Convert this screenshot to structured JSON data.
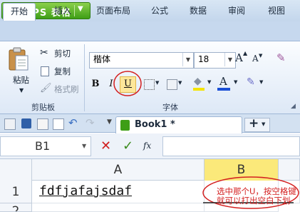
{
  "app": {
    "name": "WPS 表格"
  },
  "ribbon_tabs": [
    {
      "label": "开始",
      "active": true
    },
    {
      "label": "插入"
    },
    {
      "label": "页面布局"
    },
    {
      "label": "公式"
    },
    {
      "label": "数据"
    },
    {
      "label": "审阅"
    },
    {
      "label": "视图"
    }
  ],
  "clipboard": {
    "paste": "粘贴",
    "cut": "剪切",
    "copy": "复制",
    "format_painter": "格式刷",
    "group_label": "剪贴板"
  },
  "font": {
    "name": "楷体",
    "size": "18",
    "bold": "B",
    "italic": "I",
    "underline": "U",
    "font_color_letter": "A",
    "grow": "A",
    "shrink": "A",
    "group_label": "字体",
    "font_color": "#1a4fd6",
    "fill_color": "#f4e300",
    "annotation_color": "#d42020"
  },
  "document": {
    "tab_title": "Book1 *"
  },
  "formula_bar": {
    "cell_ref": "B1",
    "fx": "fx"
  },
  "sheet": {
    "columns": [
      "A",
      "B"
    ],
    "rows": [
      "1",
      "2"
    ],
    "cells": {
      "A1": "fdfjafajsdaf"
    }
  },
  "annotation": {
    "text": "选中那个U，按空格键就可以打出空白下划"
  },
  "icons": [
    "wps-logo-icon",
    "paste-icon",
    "cut-icon",
    "copy-icon",
    "format-painter-icon",
    "border-icon",
    "fill-icon",
    "font-color-icon",
    "grow-font-icon",
    "shrink-font-icon",
    "clear-format-icon",
    "open-icon",
    "save-icon",
    "print-icon",
    "preview-icon",
    "undo-icon",
    "redo-icon",
    "new-tab-icon",
    "cancel-icon",
    "confirm-icon"
  ]
}
